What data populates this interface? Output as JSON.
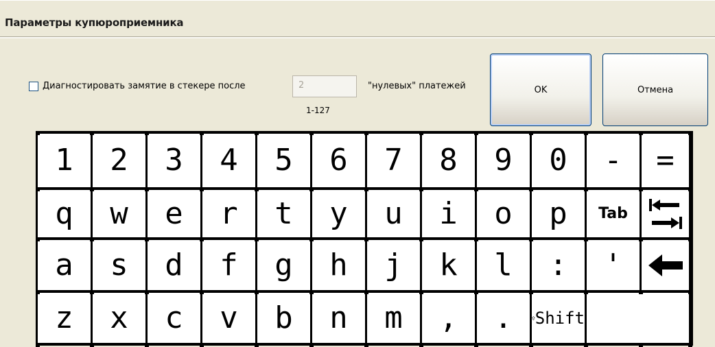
{
  "window": {
    "title": "Параметры купюроприемника"
  },
  "options": {
    "checkbox_label": "Диагностировать замятие в стекере после",
    "checkbox_checked": false,
    "count_value": "2",
    "count_range": "1-127",
    "after_label": "\"нулевых\" платежей"
  },
  "buttons": {
    "ok": "OK",
    "cancel": "Отмена"
  },
  "keyboard": {
    "row1": [
      "1",
      "2",
      "3",
      "4",
      "5",
      "6",
      "7",
      "8",
      "9",
      "0",
      "-",
      "="
    ],
    "row2": [
      "q",
      "w",
      "e",
      "r",
      "t",
      "y",
      "u",
      "i",
      "o",
      "p"
    ],
    "row2_tab_label": "Tab",
    "row2_tab_icon": "tab-arrows-icon",
    "row3": [
      "a",
      "s",
      "d",
      "f",
      "g",
      "h",
      "j",
      "k",
      "l",
      ":",
      "'"
    ],
    "row3_backspace_icon": "backspace-arrow-icon",
    "row4": [
      "z",
      "x",
      "c",
      "v",
      "b",
      "n",
      "m",
      ",",
      "."
    ],
    "row4_shift_label": "Shift",
    "row4_shift_icon": "shift-arrow-icon"
  }
}
